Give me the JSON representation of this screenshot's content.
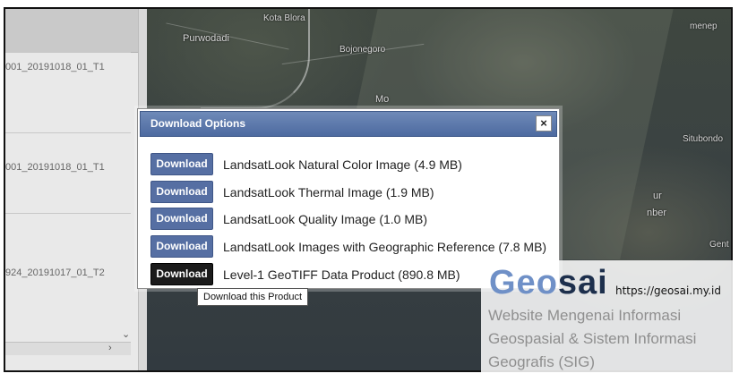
{
  "left_panel": {
    "rows": [
      {
        "text": "001_20191018_01_T1"
      },
      {
        "text": "001_20191018_01_T1"
      },
      {
        "text": "924_20191017_01_T2"
      }
    ],
    "chevron_down": "⌄",
    "chevron_right": "›"
  },
  "map": {
    "labels": [
      {
        "text": "Kota Blora"
      },
      {
        "text": "Purwodadi"
      },
      {
        "text": "Bojonegoro"
      },
      {
        "text": "Mo"
      },
      {
        "text": "Situbondo"
      },
      {
        "text": "ur"
      },
      {
        "text": "nber"
      },
      {
        "text": "Gent"
      },
      {
        "text": "menep"
      }
    ]
  },
  "dialog": {
    "title": "Download Options",
    "close_label": "×",
    "options": [
      {
        "button": "Download",
        "label": "LandsatLook Natural Color Image (4.9 MB)"
      },
      {
        "button": "Download",
        "label": "LandsatLook Thermal Image (1.9 MB)"
      },
      {
        "button": "Download",
        "label": "LandsatLook Quality Image (1.0 MB)"
      },
      {
        "button": "Download",
        "label": "LandsatLook Images with Geographic Reference (7.8 MB)"
      },
      {
        "button": "Download",
        "label": "Level-1 GeoTIFF Data Product (890.8 MB)"
      }
    ],
    "tooltip": "Download this Product"
  },
  "watermark": {
    "brand_light": "Geo",
    "brand_dark": "sai",
    "url": "https://geosai.my.id",
    "line1": "Website Mengenai Informasi",
    "line2": "Geospasial & Sistem Informasi",
    "line3": "Geografis (SIG)"
  },
  "colors": {
    "dialog_header": "#5a76aa",
    "button_blue": "#566fa3",
    "button_active": "#1b1b1b"
  }
}
